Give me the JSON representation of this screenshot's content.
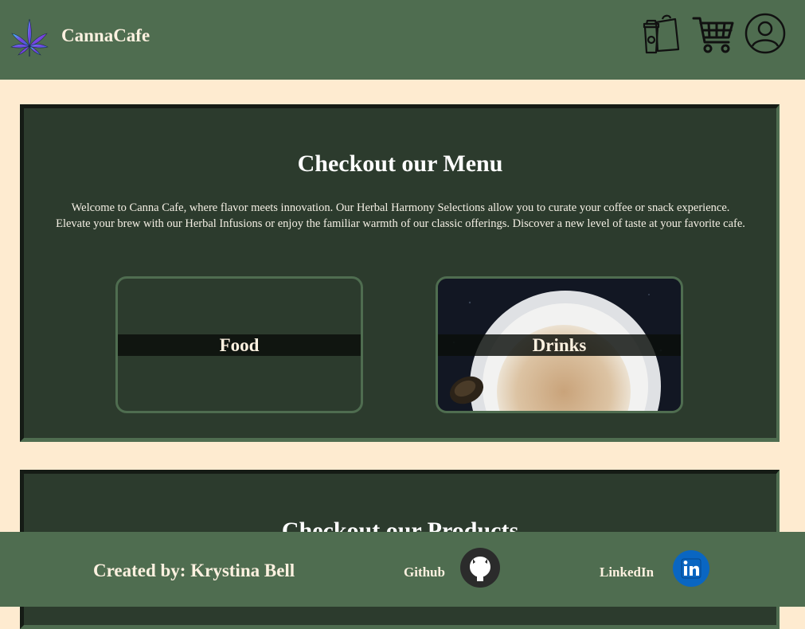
{
  "header": {
    "brand": "CannaCafe",
    "icons": [
      "cannabis-leaf-logo-icon",
      "takeout-bag-icon",
      "shopping-cart-icon",
      "user-account-icon"
    ]
  },
  "menu_section": {
    "title": "Checkout our Menu",
    "intro": "Welcome to Canna Cafe, where flavor meets innovation. Our Herbal Harmony Selections allow you to curate your coffee or snack experience. Elevate your brew with our Herbal Infusions or enjoy the familiar warmth of our classic offerings. Discover a new level of taste at your favorite cafe.",
    "cards": [
      {
        "label": "Food"
      },
      {
        "label": "Drinks"
      }
    ]
  },
  "products_section": {
    "title": "Checkout our Products"
  },
  "footer": {
    "credit": "Created by: Krystina Bell",
    "github_label": "Github",
    "linkedin_label": "LinkedIn",
    "icons": [
      "github-icon",
      "linkedin-icon"
    ]
  },
  "colors": {
    "header_bg": "#4f6d50",
    "page_bg": "#feebd0",
    "section_bg": "#2c3b2d",
    "text_light": "#fdf1e0",
    "linkedin_blue": "#0a66c2"
  }
}
